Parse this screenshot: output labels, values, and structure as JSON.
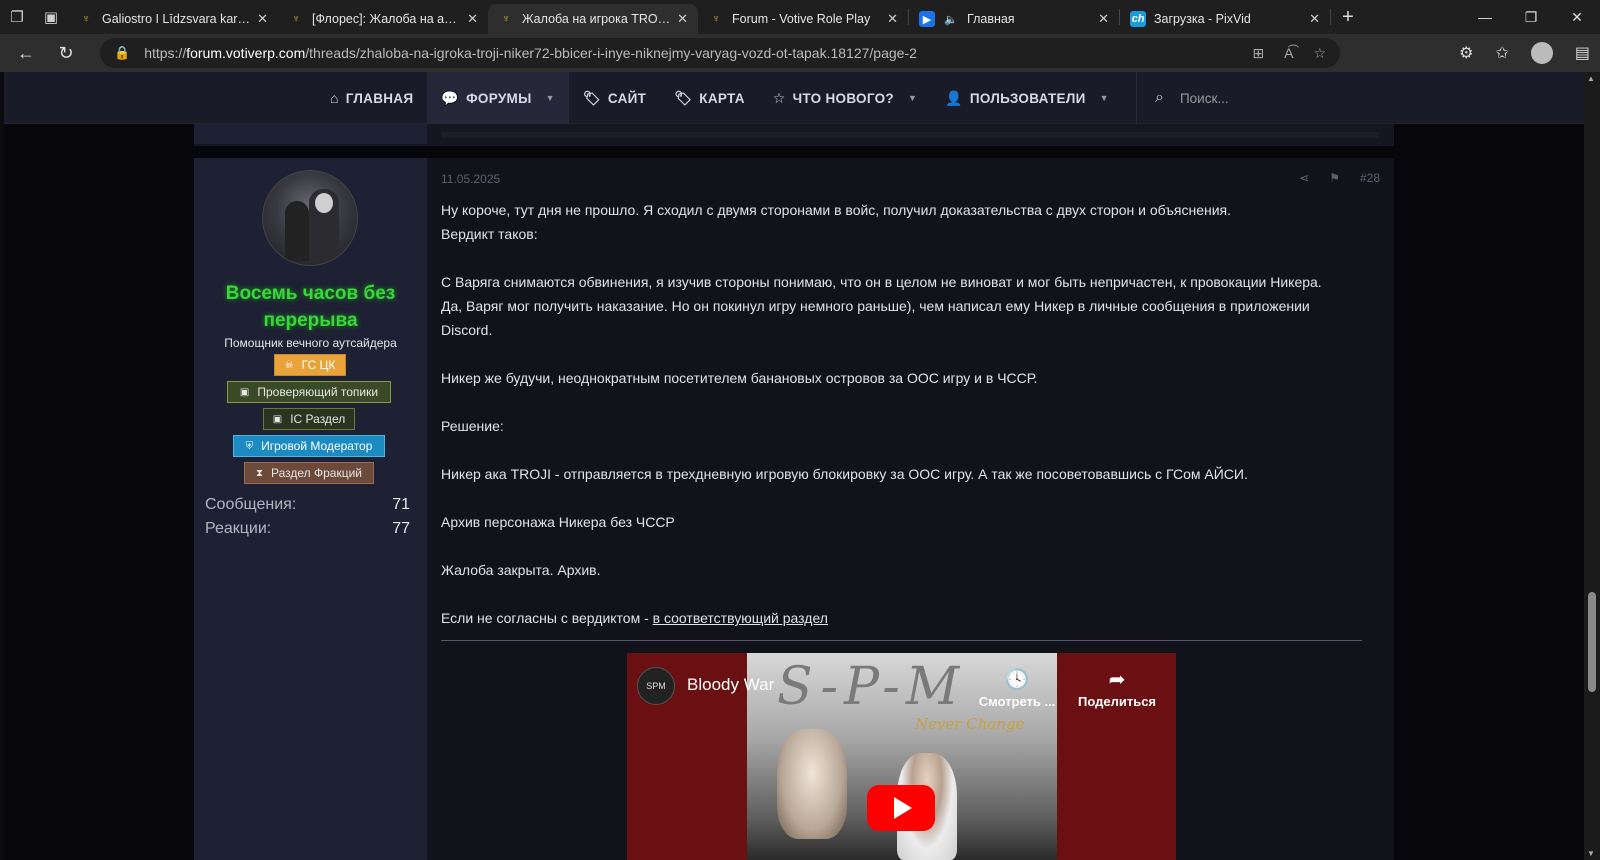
{
  "browser": {
    "tabs": [
      {
        "title": "Galiostro I Līdzsvara kari | Стр",
        "favicon": "forum-favicon",
        "active": false
      },
      {
        "title": "[Флорес]: Жалоба на админ",
        "favicon": "forum-favicon",
        "active": false
      },
      {
        "title": "Жалоба на игрока TROJI(Nik",
        "favicon": "forum-favicon",
        "active": true
      },
      {
        "title": "Forum - Votive Role Play",
        "favicon": "forum-favicon",
        "active": false
      },
      {
        "title": "Главная",
        "favicon": "pixvid-play-favicon",
        "active": false
      },
      {
        "title": "Загрузка - PixVid",
        "favicon": "ch-favicon",
        "active": false
      }
    ],
    "url_prefix": "https://",
    "url_domain": "forum.votiverp.com",
    "url_path": "/threads/zhaloba-na-igroka-troji-niker72-bbicer-i-inye-niknejmy-varyag-vozd-ot-tapak.18127/page-2"
  },
  "nav": {
    "items": [
      {
        "label": "ГЛАВНАЯ",
        "icon": "home-icon",
        "caret": false,
        "active": false
      },
      {
        "label": "ФОРУМЫ",
        "icon": "comments-icon",
        "caret": true,
        "active": true
      },
      {
        "label": "САЙТ",
        "icon": "tag-icon",
        "caret": false,
        "active": false
      },
      {
        "label": "КАРТА",
        "icon": "tag-icon",
        "caret": false,
        "active": false
      },
      {
        "label": "ЧТО НОВОГО?",
        "icon": "star-icon",
        "caret": true,
        "active": false
      },
      {
        "label": "ПОЛЬЗОВАТЕЛИ",
        "icon": "user-icon",
        "caret": true,
        "active": false
      }
    ],
    "search_placeholder": "Поиск..."
  },
  "post": {
    "username_line1": "Восемь часов без",
    "username_line2": "перерыва",
    "user_title": "Помощник вечного аутсайдера",
    "badges": [
      "ГС ЦК",
      "Проверяющий топики",
      "IC Раздел",
      "Игровой Модератор",
      "Раздел Фракций"
    ],
    "stats": [
      {
        "label": "Сообщения:",
        "value": "71"
      },
      {
        "label": "Реакции:",
        "value": "77"
      }
    ],
    "date": "11.05.2025",
    "number": "#28",
    "paragraphs": {
      "p1": "Ну короче, тут дня не прошло. Я сходил с двумя сторонами в войс, получил доказательства с двух сторон и объяснения.",
      "p2": "Вердикт таков:",
      "p3": "С Варяга снимаются обвинения, я изучив стороны понимаю, что он в целом не виноват и мог быть непричастен, к провокации Никера.",
      "p4": "Да, Варяг мог получить наказание. Но он покинул игру немного раньше), чем написал ему Никер в личные сообщения в приложении",
      "p5": "Discord.",
      "p6": "Никер же будучи, неоднократным посетителем банановых островов за ООС игру и в ЧССР.",
      "p7": "Решение:",
      "p8": "Никер ака TROJI - отправляется в трехдневную игровую блокировку за ООС игру. А так же посоветовавшись с ГСом АЙСИ.",
      "p9": "Архив персонажа Никера без ЧССР",
      "p10": "Жалоба закрыта. Архив.",
      "p11_text": "Если не согласны с вердиктом - ",
      "p11_link": "в соответствующий раздел"
    },
    "video": {
      "channel_logo": "SPM",
      "title": "Bloody War",
      "watch_later": "Смотреть ...",
      "share": "Поделиться",
      "cover_logo": "S-P-M",
      "cover_subtitle": "Never Change"
    }
  }
}
